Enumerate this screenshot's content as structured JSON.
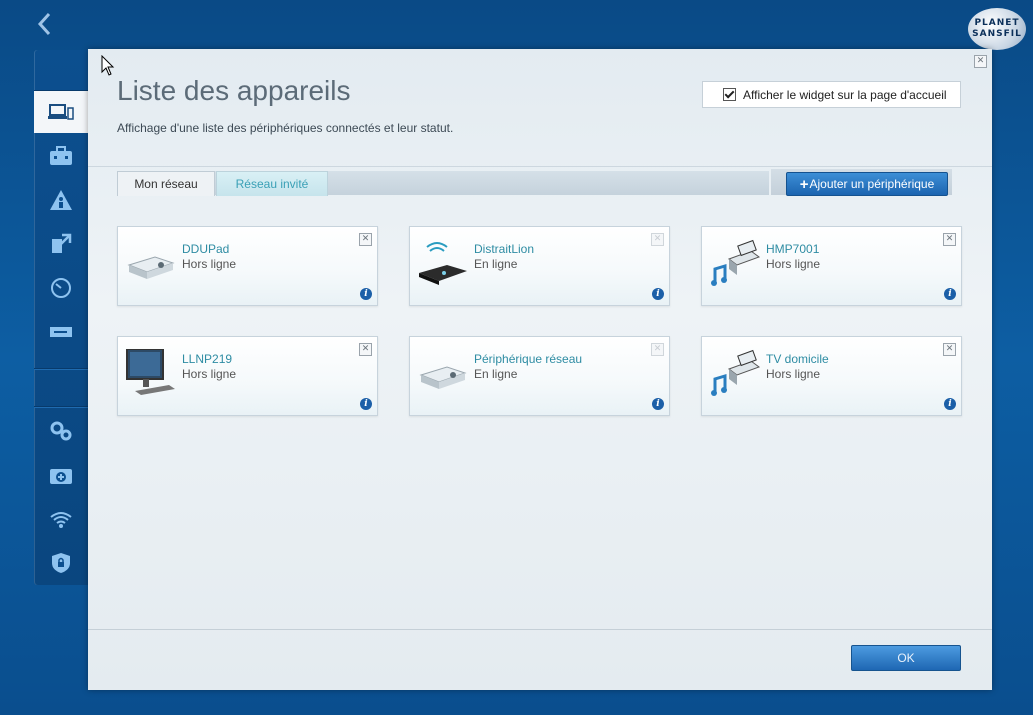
{
  "logo": {
    "line1": "PLANET",
    "line2": "SANSFIL"
  },
  "dialog": {
    "title": "Liste des appareils",
    "subtitle": "Affichage d'une liste des périphériques connectés et leur statut.",
    "widget_label": "Afficher le widget sur la page d'accueil",
    "widget_checked": true,
    "tabs": [
      {
        "label": "Mon réseau",
        "active": true
      },
      {
        "label": "Réseau invité",
        "active": false
      }
    ],
    "add_button": "Ajouter un périphérique",
    "ok_button": "OK"
  },
  "devices": [
    {
      "name": "DDUPad",
      "status": "Hors ligne",
      "icon": "storage-device-icon"
    },
    {
      "name": "DistraitLion",
      "status": "En ligne",
      "icon": "wireless-router-icon"
    },
    {
      "name": "HMP7001",
      "status": "Hors ligne",
      "icon": "media-player-icon"
    },
    {
      "name": "LLNP219",
      "status": "Hors ligne",
      "icon": "desktop-computer-icon"
    },
    {
      "name": "Périphérique réseau",
      "status": "En ligne",
      "icon": "storage-device-icon"
    },
    {
      "name": "TV domicile",
      "status": "Hors ligne",
      "icon": "media-player-icon"
    }
  ],
  "sidebar": {
    "items": [
      {
        "icon": "device-list-icon",
        "active": true
      },
      {
        "icon": "toolbox-icon"
      },
      {
        "icon": "parental-control-icon"
      },
      {
        "icon": "media-priority-icon"
      },
      {
        "icon": "speed-test-icon"
      },
      {
        "icon": "usb-storage-icon"
      },
      {
        "icon": "settings-gears-icon"
      },
      {
        "icon": "troubleshooting-icon"
      },
      {
        "icon": "wireless-icon"
      },
      {
        "icon": "security-icon"
      }
    ]
  },
  "colors": {
    "accent": "#1c64b0",
    "link": "#2e8ca3",
    "background": "#0d5ea3"
  }
}
